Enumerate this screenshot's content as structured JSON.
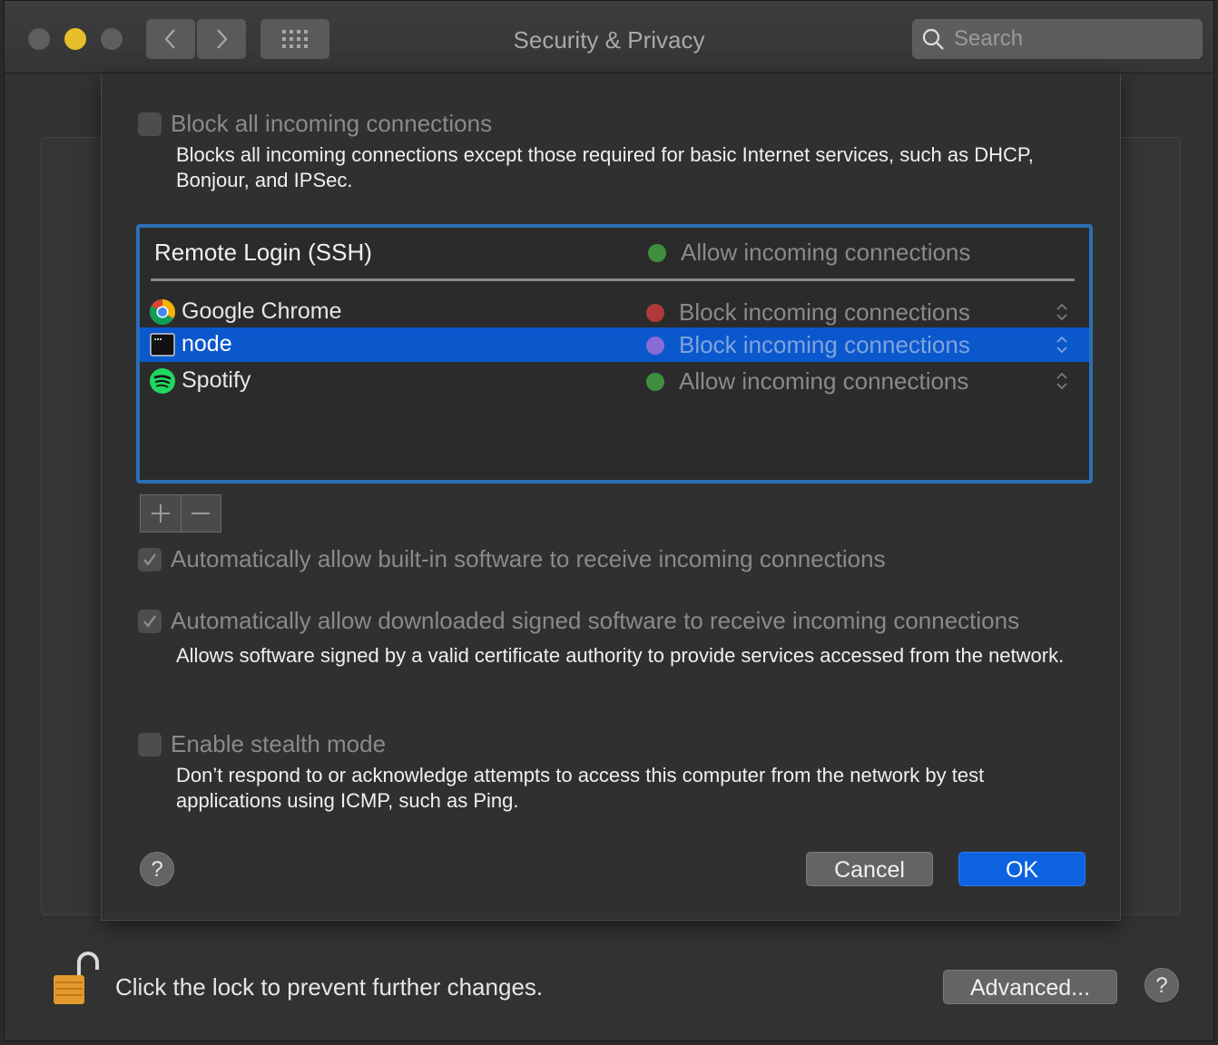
{
  "window": {
    "title": "Security & Privacy",
    "search": {
      "placeholder": "Search"
    }
  },
  "sheet": {
    "block_all": {
      "label": "Block all incoming connections",
      "checked": false,
      "description": "Blocks all incoming connections except those required for basic Internet services, such as DHCP, Bonjour, and IPSec."
    },
    "list": {
      "header": {
        "name": "Remote Login (SSH)",
        "status": "Allow incoming connections",
        "status_color": "#3f8f3f"
      },
      "rows": [
        {
          "name": "Google Chrome",
          "icon": "chrome-icon",
          "status": "Block incoming connections",
          "status_color": "#b03a3a",
          "selected": false
        },
        {
          "name": "node",
          "icon": "terminal-icon",
          "status": "Block incoming connections",
          "status_color": "#8a6ad6",
          "selected": true
        },
        {
          "name": "Spotify",
          "icon": "spotify-icon",
          "status": "Allow incoming connections",
          "status_color": "#3f8f3f",
          "selected": false
        }
      ]
    },
    "auto_builtin": {
      "label": "Automatically allow built-in software to receive incoming connections",
      "checked": true
    },
    "auto_signed": {
      "label": "Automatically allow downloaded signed software to receive incoming connections",
      "checked": true,
      "description": "Allows software signed by a valid certificate authority to provide services accessed from the network."
    },
    "stealth": {
      "label": "Enable stealth mode",
      "checked": false,
      "description": "Don’t respond to or acknowledge attempts to access this computer from the network by test applications using ICMP, such as Ping."
    },
    "help": "?",
    "cancel": "Cancel",
    "ok": "OK"
  },
  "footer": {
    "lock_text": "Click the lock to prevent further changes.",
    "advanced": "Advanced...",
    "help": "?"
  }
}
